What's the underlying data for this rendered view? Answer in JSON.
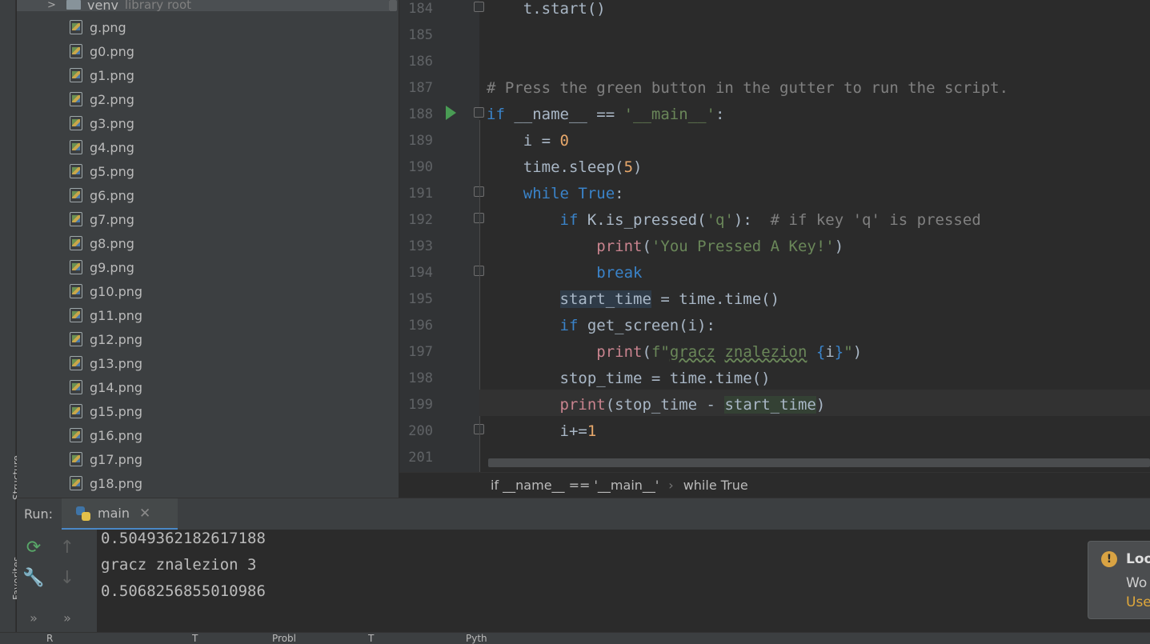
{
  "sidebar": {
    "structure_tab": "Structure",
    "favorites_tab": "Favorites"
  },
  "project": {
    "venv_label": "venv",
    "venv_note": "library root",
    "files": [
      "g.png",
      "g0.png",
      "g1.png",
      "g2.png",
      "g3.png",
      "g4.png",
      "g5.png",
      "g6.png",
      "g7.png",
      "g8.png",
      "g9.png",
      "g10.png",
      "g11.png",
      "g12.png",
      "g13.png",
      "g14.png",
      "g15.png",
      "g16.png",
      "g17.png",
      "g18.png"
    ]
  },
  "editor": {
    "line_numbers": [
      "184",
      "185",
      "186",
      "187",
      "188",
      "189",
      "190",
      "191",
      "192",
      "193",
      "194",
      "195",
      "196",
      "197",
      "198",
      "199",
      "200",
      "201"
    ]
  },
  "breadcrumb": {
    "item1": "if __name__ == '__main__'",
    "separator": "›",
    "item2": "while True"
  },
  "run": {
    "label": "Run:",
    "tab_label": "main",
    "close": "✕",
    "output": [
      "0.5049362182617188",
      "gracz znalezion 3",
      "0.5068256855010986"
    ],
    "more": "»"
  },
  "notification": {
    "title": "Loo",
    "body": "Wo",
    "link": "Use"
  },
  "status_bar": {
    "item_run": "R",
    "item_t": "T",
    "item_problems": "Probl",
    "item_terminal": "T",
    "item_python": "Pyth"
  },
  "colors": {
    "background": "#2b2b2b",
    "panel": "#3c3f41",
    "keyword": "#cc7832",
    "string": "#6a8759",
    "accent": "#4a88c7"
  }
}
